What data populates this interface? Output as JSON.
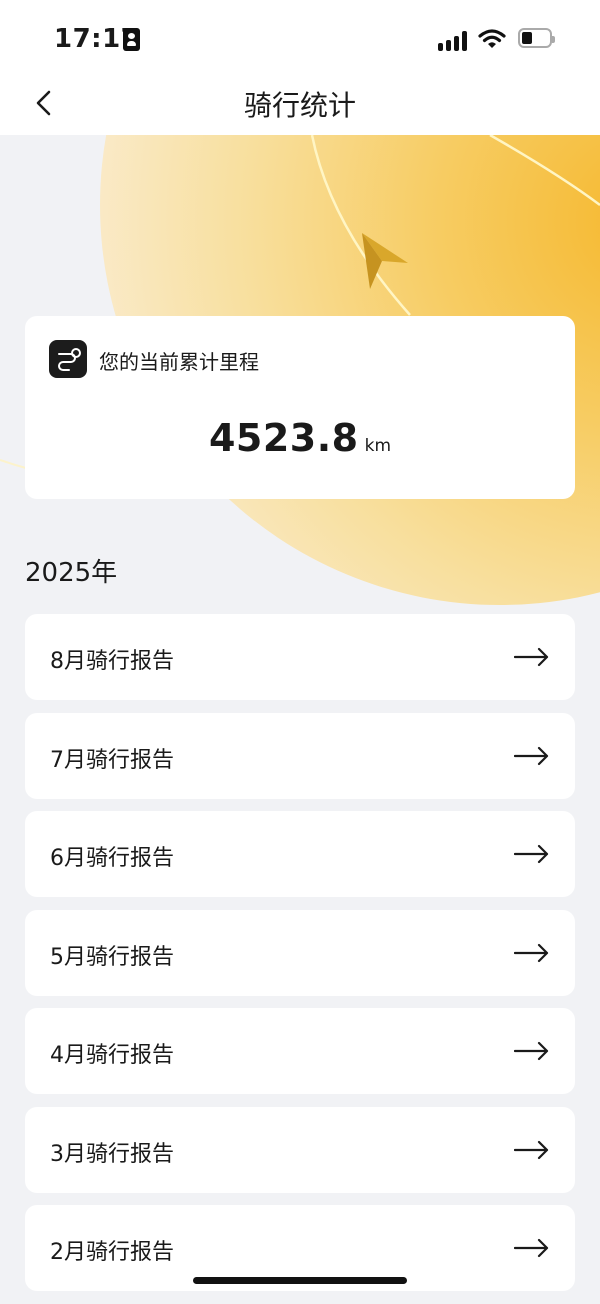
{
  "status_bar": {
    "time": "17:17",
    "icons": [
      "id-card-icon",
      "signal-icon",
      "wifi-icon",
      "battery-icon"
    ],
    "battery_level": 0.3
  },
  "nav": {
    "title": "骑行统计",
    "back_icon": "chevron-left-icon"
  },
  "mileage_card": {
    "icon": "route-icon",
    "label": "您的当前累计里程",
    "value": "4523.8",
    "unit": "km"
  },
  "year_section": {
    "year_label": "2025年",
    "reports": [
      {
        "label": "8月骑行报告"
      },
      {
        "label": "7月骑行报告"
      },
      {
        "label": "6月骑行报告"
      },
      {
        "label": "5月骑行报告"
      },
      {
        "label": "4月骑行报告"
      },
      {
        "label": "3月骑行报告"
      },
      {
        "label": "2月骑行报告"
      }
    ]
  },
  "colors": {
    "accent": "#f5b82e",
    "background": "#f1f2f5",
    "card": "#ffffff",
    "text": "#1a1a1a"
  }
}
